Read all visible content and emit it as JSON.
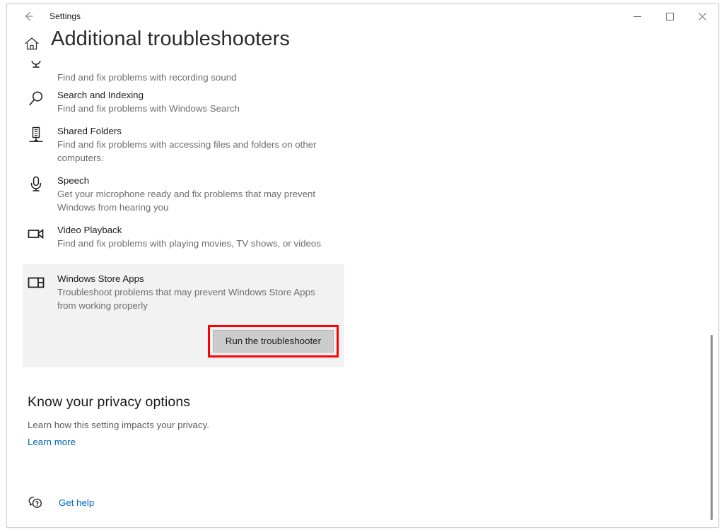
{
  "window": {
    "app_title": "Settings",
    "back_icon": "back-arrow-icon",
    "minimize_label": "─",
    "maximize_label": "☐",
    "close_label": "✕"
  },
  "page": {
    "home_icon": "home-icon",
    "title": "Additional troubleshooters"
  },
  "troubleshooters": [
    {
      "icon": "recording-mic-icon",
      "name": "",
      "desc": "Find and fix problems with recording sound",
      "clipped": true
    },
    {
      "icon": "search-icon",
      "name": "Search and Indexing",
      "desc": "Find and fix problems with Windows Search"
    },
    {
      "icon": "shared-folders-icon",
      "name": "Shared Folders",
      "desc": "Find and fix problems with accessing files and folders on other computers."
    },
    {
      "icon": "microphone-icon",
      "name": "Speech",
      "desc": "Get your microphone ready and fix problems that may prevent Windows from hearing you"
    },
    {
      "icon": "video-camera-icon",
      "name": "Video Playback",
      "desc": "Find and fix problems with playing movies, TV shows, or videos"
    }
  ],
  "selected_item": {
    "icon": "windows-store-apps-icon",
    "name": "Windows Store Apps",
    "desc": "Troubleshoot problems that may prevent Windows Store Apps from working properly",
    "button_label": "Run the troubleshooter",
    "highlight_color": "#ff0000",
    "background_color": "#f2f2f2",
    "button_color": "#cccccc"
  },
  "privacy": {
    "title": "Know your privacy options",
    "subtitle": "Learn how this setting impacts your privacy.",
    "link_label": "Learn more",
    "link_color": "#0067c0"
  },
  "help": {
    "icon": "question-bubble-icon",
    "label": "Get help"
  }
}
